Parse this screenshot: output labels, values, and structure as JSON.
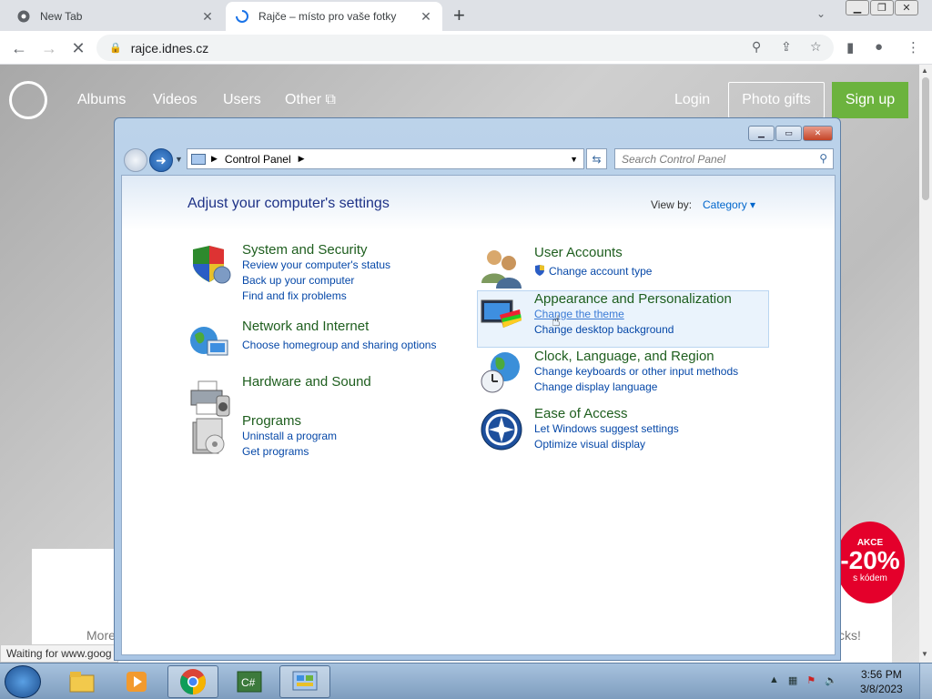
{
  "browser": {
    "tabs": [
      {
        "title": "New Tab",
        "active": false
      },
      {
        "title": "Rajče – místo pro vaše fotky",
        "active": true
      }
    ],
    "new_tab": "+",
    "tab_search": "⌄",
    "url": "rajce.idnes.cz",
    "status_text": "Waiting for www.goog"
  },
  "site": {
    "nav": [
      "Albums",
      "Videos",
      "Users",
      "Other ⧉"
    ],
    "login": "Login",
    "photo_gifts": "Photo gifts",
    "signup": "Sign up",
    "more": "More",
    "checks": "cks!",
    "badge": {
      "line1": "AKCE",
      "line2": "-20%",
      "line3": "s kódem"
    }
  },
  "control_panel": {
    "address": "Control Panel",
    "search_placeholder": "Search Control Panel",
    "heading": "Adjust your computer's settings",
    "view_by_label": "View by:",
    "view_by_value": "Category ▾",
    "left_categories": [
      {
        "title": "System and Security",
        "links": [
          "Review your computer's status",
          "Back up your computer",
          "Find and fix problems"
        ]
      },
      {
        "title": "Network and Internet",
        "links": [
          "Choose homegroup and sharing options"
        ]
      },
      {
        "title": "Hardware and Sound",
        "links": []
      },
      {
        "title": "Programs",
        "links": [
          "Uninstall a program",
          "Get programs"
        ]
      }
    ],
    "right_categories": [
      {
        "title": "User Accounts",
        "links": [
          "Change account type"
        ]
      },
      {
        "title": "Appearance and Personalization",
        "links": [
          "Change the theme",
          "Change desktop background"
        ]
      },
      {
        "title": "Clock, Language, and Region",
        "links": [
          "Change keyboards or other input methods",
          "Change display language"
        ]
      },
      {
        "title": "Ease of Access",
        "links": [
          "Let Windows suggest settings",
          "Optimize visual display"
        ]
      }
    ]
  },
  "taskbar": {
    "time": "3:56 PM",
    "date": "3/8/2023",
    "apps": [
      "explorer-icon",
      "media-player-icon",
      "chrome-icon",
      "csharp-icon",
      "control-panel-icon"
    ]
  }
}
